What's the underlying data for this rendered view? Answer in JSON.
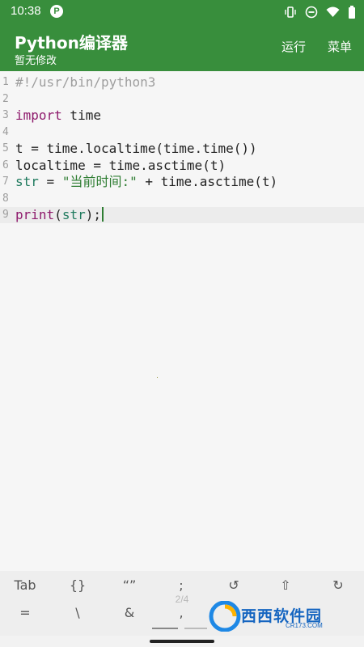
{
  "status": {
    "time": "10:38",
    "app_icon": "P",
    "icons": [
      "vibrate-icon",
      "dnd-icon",
      "wifi-icon",
      "battery-icon"
    ]
  },
  "appbar": {
    "title": "Python编译器",
    "subtitle": "暂无修改",
    "run_label": "运行",
    "menu_label": "菜单"
  },
  "editor": {
    "line_numbers": [
      "1",
      "2",
      "3",
      "4",
      "5",
      "6",
      "7",
      "8",
      "9"
    ],
    "current_line": 9,
    "lines": [
      [
        {
          "t": "#!/usr/bin/python3",
          "k": "comment"
        }
      ],
      [],
      [
        {
          "t": "import",
          "k": "kw"
        },
        {
          "t": " time",
          "k": "plain"
        }
      ],
      [],
      [
        {
          "t": "t = time.localtime(time.time())",
          "k": "plain"
        }
      ],
      [
        {
          "t": "localtime = time.asctime(t)",
          "k": "plain"
        }
      ],
      [
        {
          "t": "str",
          "k": "builtin"
        },
        {
          "t": " = ",
          "k": "plain"
        },
        {
          "t": "\"当前时间:\"",
          "k": "str"
        },
        {
          "t": " + time.asctime(t)",
          "k": "plain"
        }
      ],
      [],
      [
        {
          "t": "print",
          "k": "kw"
        },
        {
          "t": "(",
          "k": "plain"
        },
        {
          "t": "str",
          "k": "builtin"
        },
        {
          "t": ");",
          "k": "plain"
        }
      ]
    ]
  },
  "symbols": {
    "row1": [
      "Tab",
      "{}",
      "“”",
      ";",
      "↺",
      "⇧",
      "↻"
    ],
    "row2": [
      "=",
      "\\",
      "&",
      ","
    ],
    "page_indicator": "2/4"
  },
  "watermark": {
    "text": "西西软件园",
    "sub": "CR173.COM"
  },
  "colors": {
    "primary": "#388e3c",
    "keyword": "#8e1a6c",
    "builtin": "#1f7a5e",
    "string": "#2e7d32",
    "comment": "#9e9e9e"
  }
}
